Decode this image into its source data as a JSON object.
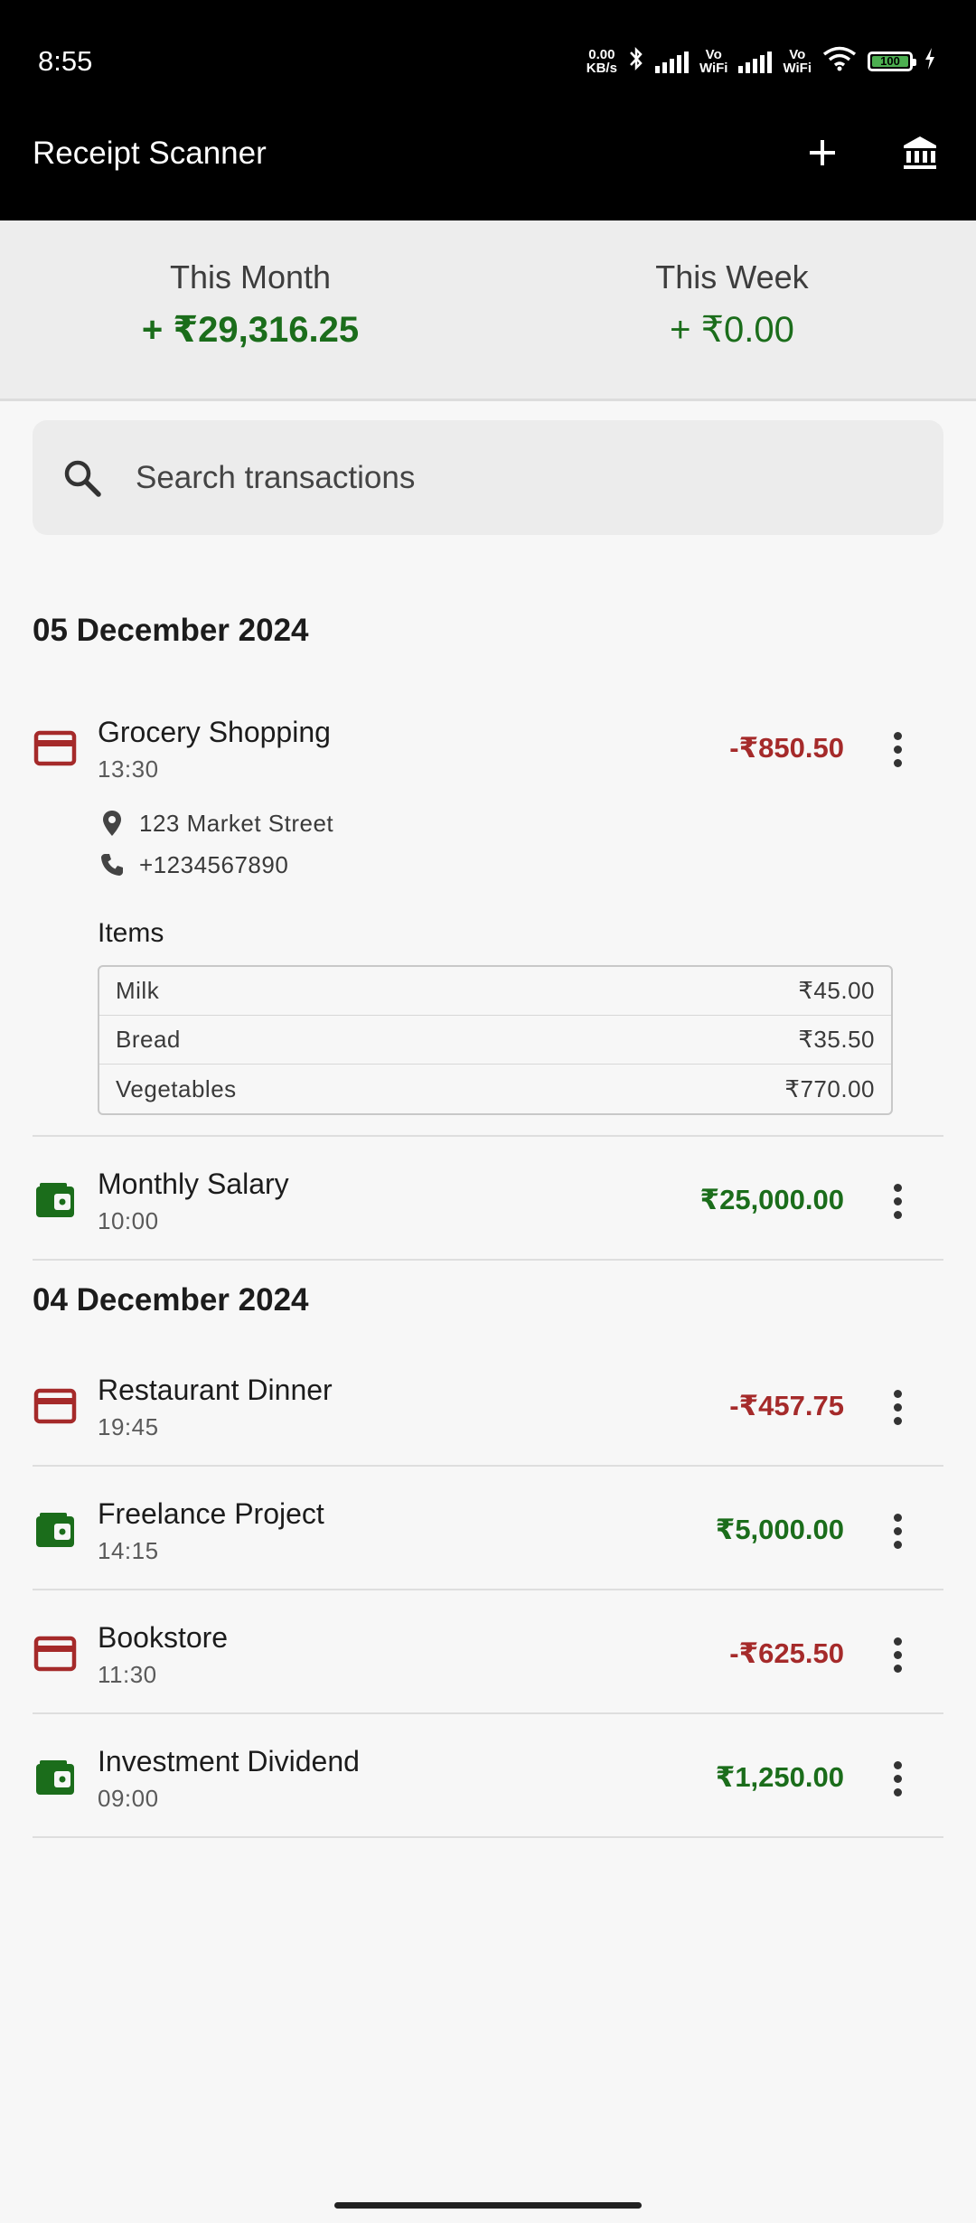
{
  "status_bar": {
    "time": "8:55",
    "net_speed_value": "0.00",
    "net_speed_unit": "KB/s",
    "vowifi_1_a": "Vo",
    "vowifi_1_b": "WiFi",
    "vowifi_2_a": "Vo",
    "vowifi_2_b": "WiFi",
    "battery": "100"
  },
  "app_bar": {
    "title": "Receipt Scanner",
    "add_icon": "plus-icon",
    "bank_icon": "bank-icon"
  },
  "summary": {
    "month_label": "This Month",
    "month_value": "+ ₹29,316.25",
    "week_label": "This Week",
    "week_value": "+ ₹0.00"
  },
  "search": {
    "placeholder": "Search transactions"
  },
  "groups": [
    {
      "date": "05 December 2024",
      "transactions": [
        {
          "title": "Grocery Shopping",
          "time": "13:30",
          "amount": "-₹850.50",
          "type": "expense",
          "address": "123 Market Street",
          "phone": "+1234567890",
          "items_label": "Items",
          "items": [
            {
              "name": "Milk",
              "price": "₹45.00"
            },
            {
              "name": "Bread",
              "price": "₹35.50"
            },
            {
              "name": "Vegetables",
              "price": "₹770.00"
            }
          ]
        },
        {
          "title": "Monthly Salary",
          "time": "10:00",
          "amount": "₹25,000.00",
          "type": "income"
        }
      ]
    },
    {
      "date": "04 December 2024",
      "transactions": [
        {
          "title": "Restaurant Dinner",
          "time": "19:45",
          "amount": "-₹457.75",
          "type": "expense"
        },
        {
          "title": "Freelance Project",
          "time": "14:15",
          "amount": "₹5,000.00",
          "type": "income"
        },
        {
          "title": "Bookstore",
          "time": "11:30",
          "amount": "-₹625.50",
          "type": "expense"
        },
        {
          "title": "Investment Dividend",
          "time": "09:00",
          "amount": "₹1,250.00",
          "type": "income"
        }
      ]
    }
  ],
  "colors": {
    "expense": "#a52a2a",
    "income": "#1b6d1b",
    "app_bar": "#000000"
  }
}
